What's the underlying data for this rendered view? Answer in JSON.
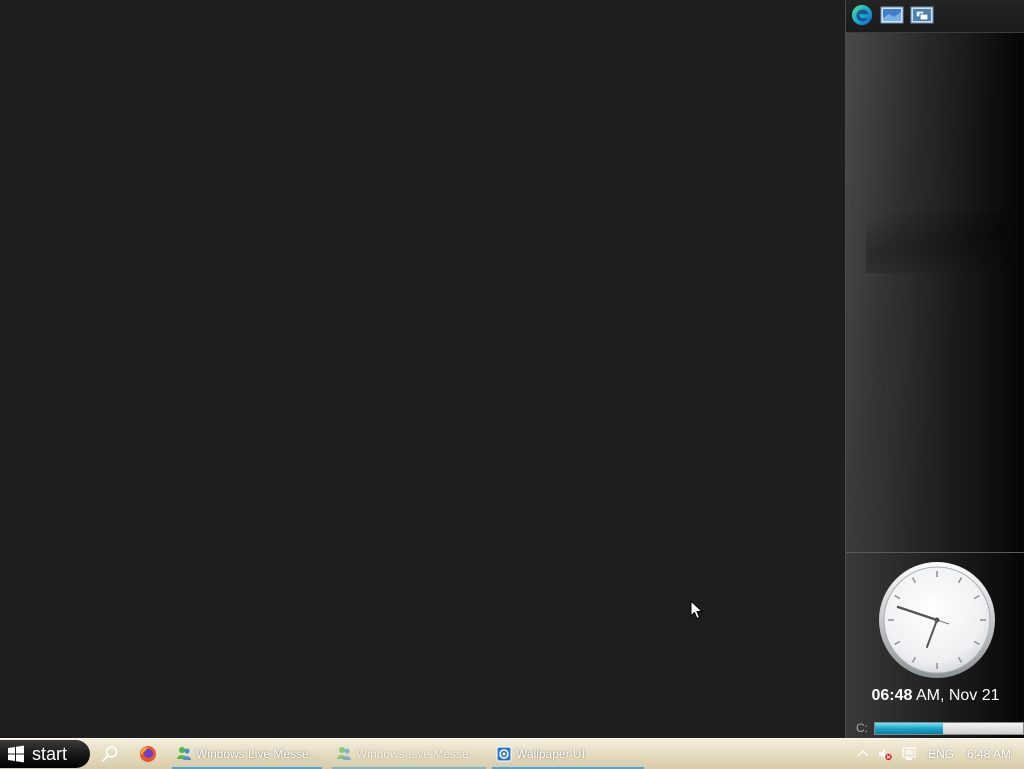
{
  "sidebar": {
    "quick_launch": [
      {
        "icon": "edge-icon"
      },
      {
        "icon": "show-desktop-icon"
      },
      {
        "icon": "switch-windows-icon"
      }
    ],
    "clock": {
      "time": "06:48",
      "meridiem_date": " AM, Nov 21"
    },
    "drive": {
      "label": "C:",
      "used_fraction": 0.46,
      "fill_color": "#1aa6c8"
    }
  },
  "taskbar": {
    "start_label": "start",
    "tasks": [
      {
        "label": "Windows Live Messe...",
        "icon": "messenger-icon"
      },
      {
        "label": "Windows Live Messe...",
        "icon": "messenger-icon"
      },
      {
        "label": "Wallpaper UI",
        "icon": "wallpaper-ui-icon"
      }
    ],
    "tray": {
      "language": "ENG",
      "time": "6:48 AM"
    }
  },
  "colors": {
    "desktop": "#1e1e1e",
    "taskbar": "#e8e0c6",
    "accent": "#4aa9d6"
  }
}
